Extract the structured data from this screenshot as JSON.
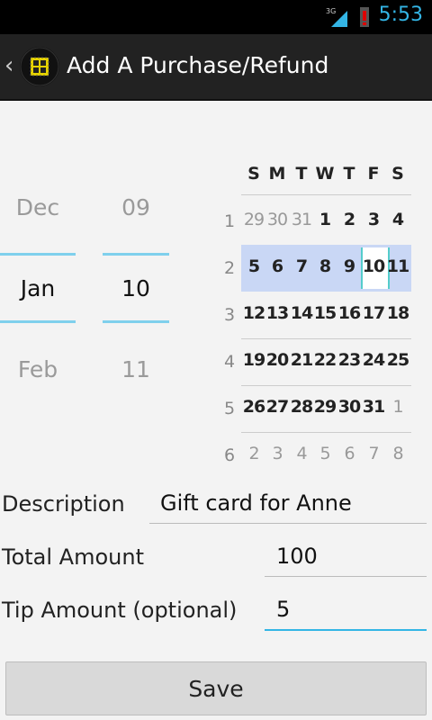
{
  "statusbar": {
    "network": "3G",
    "time": "5:53"
  },
  "actionbar": {
    "title": "Add A Purchase/Refund"
  },
  "month_picker": {
    "prev": "Dec",
    "current": "Jan",
    "next": "Feb"
  },
  "day_picker": {
    "prev": "09",
    "current": "10",
    "next": "11"
  },
  "calendar": {
    "weekdays": [
      "S",
      "M",
      "T",
      "W",
      "T",
      "F",
      "S"
    ],
    "selected_week": 2,
    "selected_day": "10",
    "weeks": [
      {
        "num": "1",
        "days": [
          "29",
          "30",
          "31",
          "1",
          "2",
          "3",
          "4"
        ]
      },
      {
        "num": "2",
        "days": [
          "5",
          "6",
          "7",
          "8",
          "9",
          "10",
          "11"
        ]
      },
      {
        "num": "3",
        "days": [
          "12",
          "13",
          "14",
          "15",
          "16",
          "17",
          "18"
        ]
      },
      {
        "num": "4",
        "days": [
          "19",
          "20",
          "21",
          "22",
          "23",
          "24",
          "25"
        ]
      },
      {
        "num": "5",
        "days": [
          "26",
          "27",
          "28",
          "29",
          "30",
          "31",
          "1"
        ]
      },
      {
        "num": "6",
        "days": [
          "2",
          "3",
          "4",
          "5",
          "6",
          "7",
          "8"
        ]
      }
    ]
  },
  "form": {
    "description_label": "Description",
    "description_value": "Gift card for Anne",
    "total_label": "Total Amount",
    "total_value": "100",
    "tip_label": "Tip Amount (optional)",
    "tip_value": "5"
  },
  "save_label": "Save"
}
